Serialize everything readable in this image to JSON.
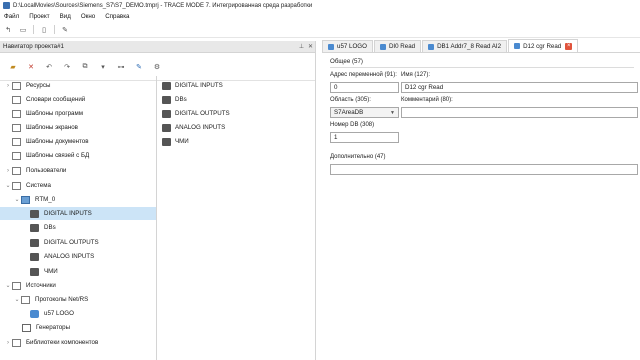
{
  "window": {
    "title": "D:\\LocalMovies\\Sources\\Siemens_S7\\S7_DEMO.tmprj - TRACE MODE 7. Интегрированная среда разработки"
  },
  "menu": [
    "Файл",
    "Проект",
    "Вид",
    "Окно",
    "Справка"
  ],
  "navigator": {
    "title": "Навигатор проекта#1",
    "tree": [
      {
        "label": "Ресурсы",
        "expander": "›",
        "icon": "doc"
      },
      {
        "label": "Словари сообщений",
        "expander": "",
        "icon": "doc"
      },
      {
        "label": "Шаблоны программ",
        "expander": "",
        "icon": "doc"
      },
      {
        "label": "Шаблоны экранов",
        "expander": "",
        "icon": "doc"
      },
      {
        "label": "Шаблоны документов",
        "expander": "",
        "icon": "doc"
      },
      {
        "label": "Шаблоны связей с БД",
        "expander": "",
        "icon": "doc"
      },
      {
        "label": "Пользователи",
        "expander": "›",
        "icon": "doc"
      },
      {
        "label": "Система",
        "expander": "⌄",
        "icon": "doc"
      },
      {
        "label": "RTM_0",
        "expander": "⌄",
        "icon": "pc"
      },
      {
        "label": "DIGITAL INPUTS",
        "expander": "",
        "icon": "db"
      },
      {
        "label": "DBs",
        "expander": "",
        "icon": "db"
      },
      {
        "label": "DIGITAL OUTPUTS",
        "expander": "",
        "icon": "db"
      },
      {
        "label": "ANALOG INPUTS",
        "expander": "",
        "icon": "db"
      },
      {
        "label": "ЧМИ",
        "expander": "",
        "icon": "db"
      },
      {
        "label": "Источники",
        "expander": "⌄",
        "icon": "doc"
      },
      {
        "label": "Протоколы Net/RS",
        "expander": "⌄",
        "icon": "doc"
      },
      {
        "label": "u57 LOGO",
        "expander": "",
        "icon": "net"
      },
      {
        "label": "Генераторы",
        "expander": "",
        "icon": "gen"
      },
      {
        "label": "Библиотеки компонентов",
        "expander": "›",
        "icon": "doc"
      }
    ],
    "list": [
      "DIGITAL INPUTS",
      "DBs",
      "DIGITAL OUTPUTS",
      "ANALOG INPUTS",
      "ЧМИ"
    ]
  },
  "tabs": [
    {
      "label": "u57 LOGO",
      "active": false
    },
    {
      "label": "DI0 Read",
      "active": false
    },
    {
      "label": "DB1 Addr7_8 Read AI2",
      "active": false
    },
    {
      "label": "D12 cgr Read",
      "active": true
    }
  ],
  "props": {
    "section": "Общее (57)",
    "addr_label": "Адрес переменной (91):",
    "addr_value": "0",
    "name_label": "Имя (127):",
    "name_value": "D12 cgr Read",
    "area_label": "Область (305):",
    "area_value": "S7AreaDB",
    "comment_label": "Комментарий (80):",
    "comment_value": "",
    "dbnum_label": "Номер DB (308)",
    "dbnum_value": "1",
    "extra_label": "Дополнительно (47)",
    "extra_value": ""
  }
}
